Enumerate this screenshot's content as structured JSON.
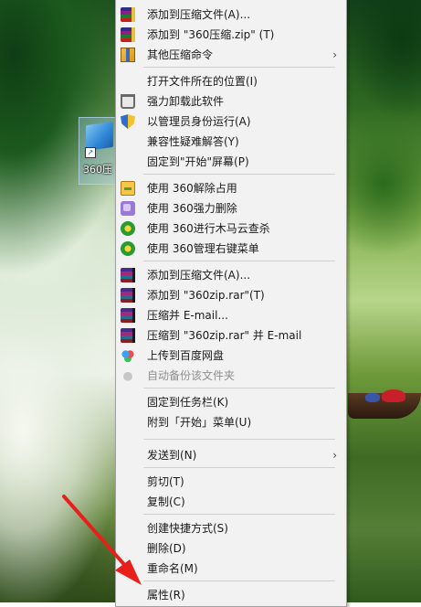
{
  "desktop": {
    "icon_label": "360压"
  },
  "menu": {
    "items": [
      {
        "label": "添加到压缩文件(A)...",
        "icon": "zip-archive-icon"
      },
      {
        "label": "添加到 \"360压缩.zip\" (T)",
        "icon": "zip-archive-icon"
      },
      {
        "label": "其他压缩命令",
        "icon": "zip-box-icon",
        "submenu_glyph": "›"
      },
      {
        "label": "打开文件所在的位置(I)",
        "icon": ""
      },
      {
        "label": "强力卸载此软件",
        "icon": "trash-icon"
      },
      {
        "label": "以管理员身份运行(A)",
        "icon": "uac-shield-icon"
      },
      {
        "label": "兼容性疑难解答(Y)",
        "icon": ""
      },
      {
        "label": "固定到\"开始\"屏幕(P)",
        "icon": ""
      },
      {
        "label": "使用 360解除占用",
        "icon": "unlock-icon"
      },
      {
        "label": "使用 360强力删除",
        "icon": "shred-icon"
      },
      {
        "label": "使用 360进行木马云查杀",
        "icon": "360-scan-icon"
      },
      {
        "label": "使用 360管理右键菜单",
        "icon": "360-scan-icon"
      },
      {
        "label": "添加到压缩文件(A)...",
        "icon": "winrar-icon"
      },
      {
        "label": "添加到 \"360zip.rar\"(T)",
        "icon": "winrar-icon"
      },
      {
        "label": "压缩并 E-mail...",
        "icon": "winrar-icon"
      },
      {
        "label": "压缩到 \"360zip.rar\" 并 E-mail",
        "icon": "winrar-icon"
      },
      {
        "label": "上传到百度网盘",
        "icon": "baidu-cloud-icon"
      },
      {
        "label": "自动备份该文件夹",
        "icon": "baidu-cloud-gray-icon",
        "disabled": true
      },
      {
        "label": "固定到任务栏(K)",
        "icon": ""
      },
      {
        "label": "附到「开始」菜单(U)",
        "icon": ""
      },
      {
        "label": "发送到(N)",
        "icon": "",
        "submenu_glyph": "›"
      },
      {
        "label": "剪切(T)",
        "icon": ""
      },
      {
        "label": "复制(C)",
        "icon": ""
      },
      {
        "label": "创建快捷方式(S)",
        "icon": ""
      },
      {
        "label": "删除(D)",
        "icon": ""
      },
      {
        "label": "重命名(M)",
        "icon": ""
      },
      {
        "label": "属性(R)",
        "icon": ""
      }
    ]
  },
  "colors": {
    "menu_background": "#f2f2f2",
    "arrow": "#e8201c"
  }
}
